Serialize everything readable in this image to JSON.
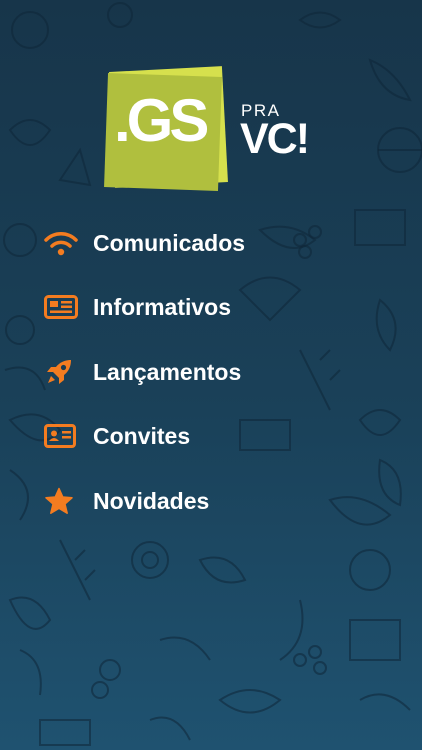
{
  "colors": {
    "accent": "#f47c20",
    "logo_green": "#b0bf3e",
    "background": "#1a3c52"
  },
  "logo": {
    "main": ".GS",
    "small": "PRA",
    "large": "VC!"
  },
  "menu": [
    {
      "label": "Comunicados",
      "icon": "wifi-icon"
    },
    {
      "label": "Informativos",
      "icon": "newspaper-icon"
    },
    {
      "label": "Lançamentos",
      "icon": "rocket-icon"
    },
    {
      "label": "Convites",
      "icon": "id-card-icon"
    },
    {
      "label": "Novidades",
      "icon": "star-icon"
    }
  ]
}
